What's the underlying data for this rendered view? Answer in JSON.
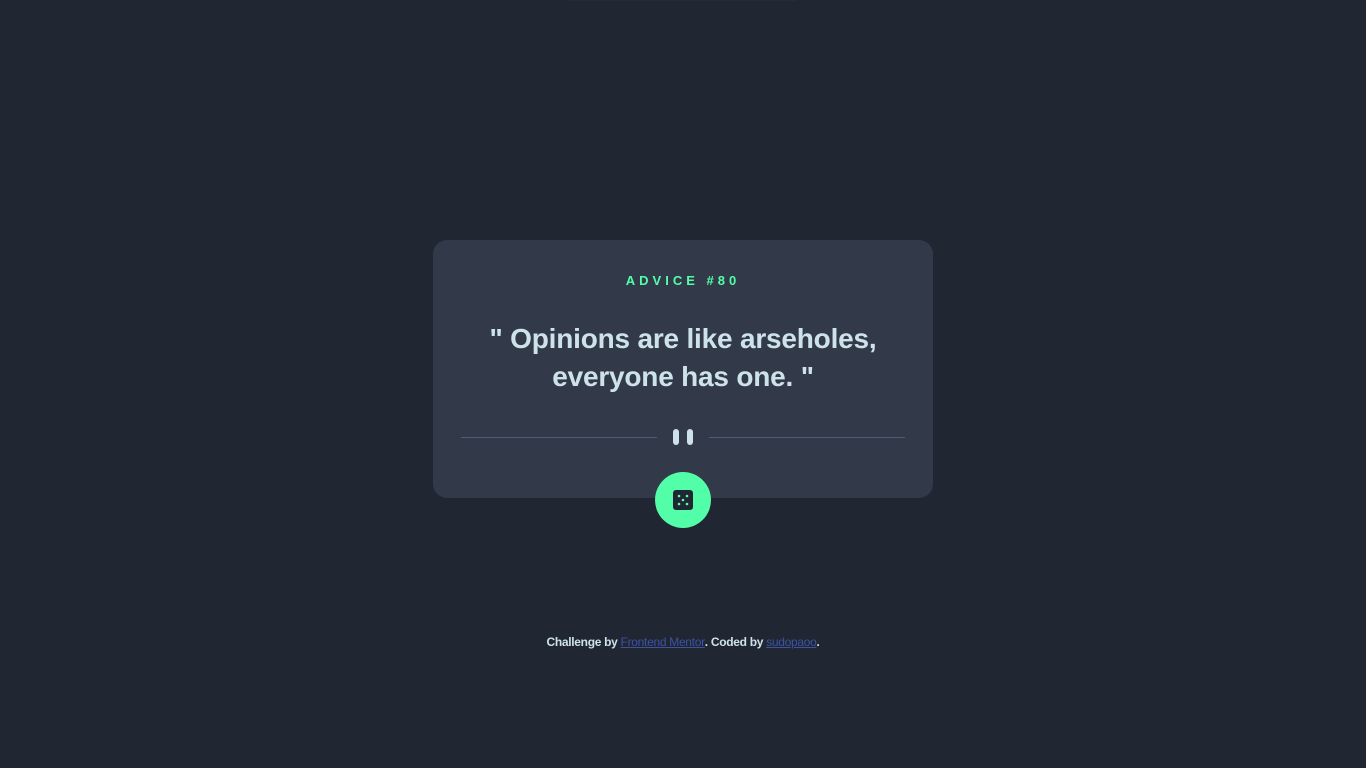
{
  "card": {
    "advice_label": "ADVICE #80",
    "quote": "\" Opinions are like arseholes, everyone has one. \""
  },
  "divider": {
    "icon": "pause-icon"
  },
  "dice_button": {
    "icon": "dice-icon",
    "color": "#52ffa8"
  },
  "footer": {
    "prefix": "Challenge by ",
    "link1": "Frontend Mentor",
    "middle": ". Coded by ",
    "link2": "sudopaoo",
    "suffix": "."
  },
  "colors": {
    "background": "#202632",
    "card": "#323a49",
    "accent": "#52ffa8",
    "text": "#cee3e9",
    "link": "#3e52a3"
  }
}
